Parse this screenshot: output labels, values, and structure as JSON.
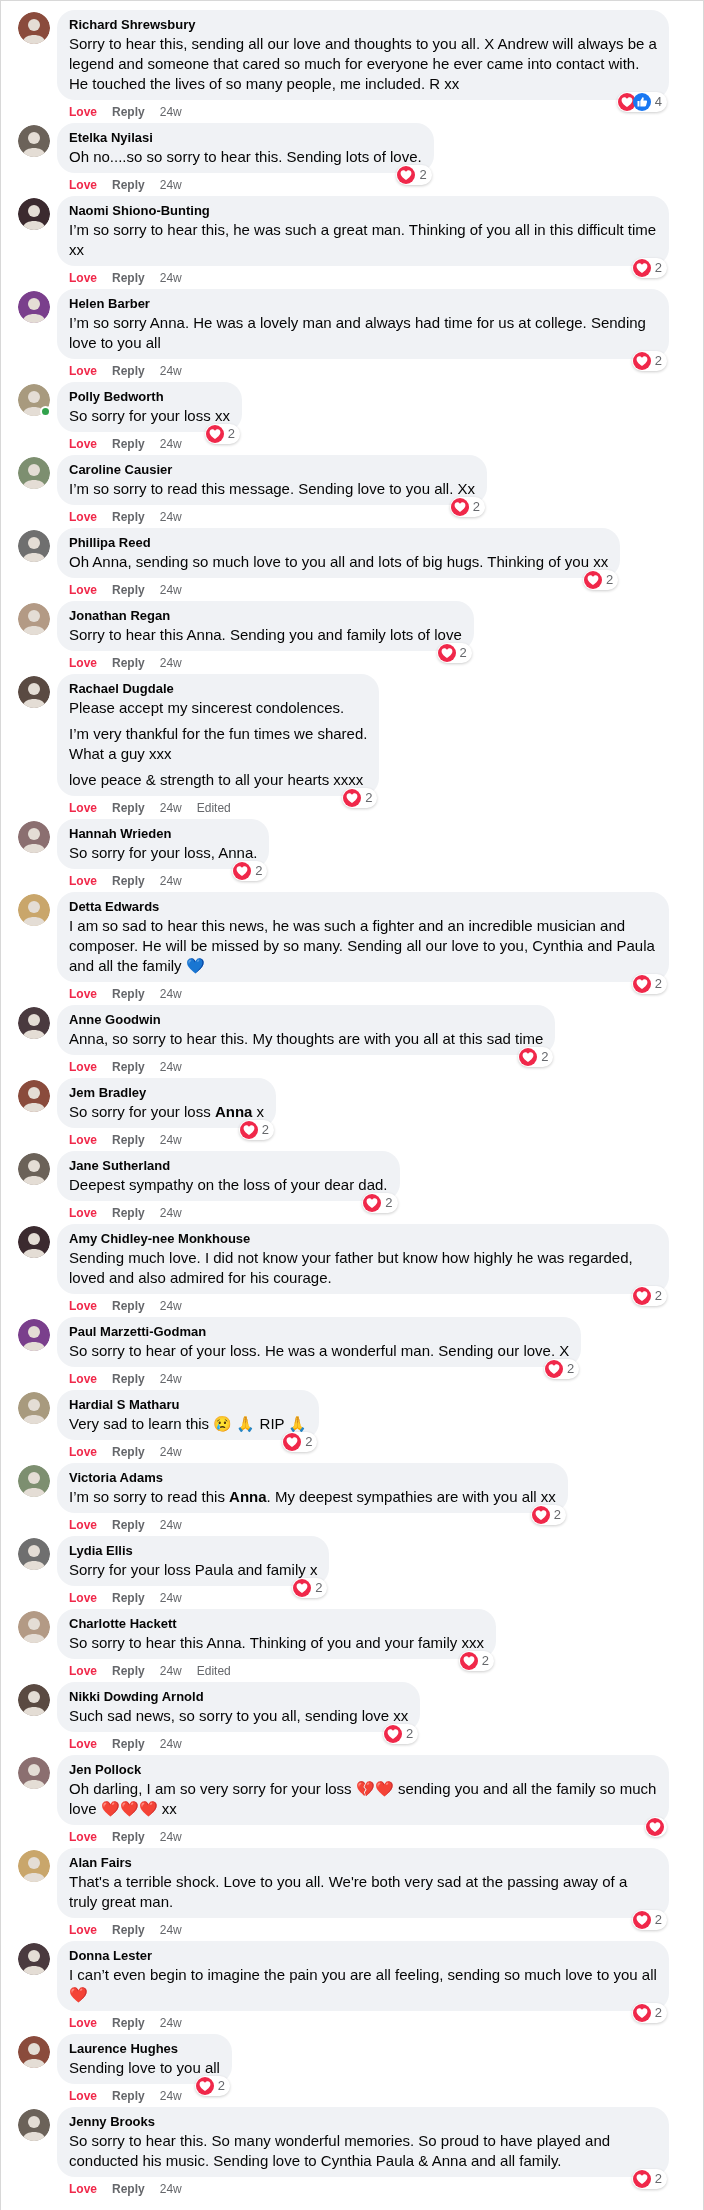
{
  "comments": [
    {
      "author": "Richard Shrewsbury",
      "online": false,
      "paragraphs": [
        "Sorry to hear this, sending all our love and thoughts to you all. X Andrew will always be a legend and someone that cared so much for everyone he ever came into contact with. He touched the lives of so many people, me included. R xx"
      ],
      "loved": true,
      "actions": {
        "love": "Love",
        "reply": "Reply",
        "time": "24w"
      },
      "reactions": {
        "items": [
          {
            "kind": "love"
          },
          {
            "kind": "like"
          }
        ],
        "count": "4"
      }
    },
    {
      "author": "Etelka Nyilasi",
      "online": false,
      "paragraphs": [
        "Oh no....so so sorry to hear this. Sending lots of love."
      ],
      "loved": true,
      "actions": {
        "love": "Love",
        "reply": "Reply",
        "time": "24w"
      },
      "reactions": {
        "items": [
          {
            "kind": "love"
          }
        ],
        "count": "2"
      }
    },
    {
      "author": "Naomi Shiono-Bunting",
      "online": false,
      "paragraphs": [
        "I’m so sorry to hear this, he was such a great man. Thinking of you all in this difficult time xx"
      ],
      "loved": true,
      "actions": {
        "love": "Love",
        "reply": "Reply",
        "time": "24w"
      },
      "reactions": {
        "items": [
          {
            "kind": "love"
          }
        ],
        "count": "2"
      }
    },
    {
      "author": "Helen Barber",
      "online": false,
      "paragraphs": [
        "I’m so sorry Anna. He was a lovely man and always had time for us at college. Sending love to you all"
      ],
      "loved": true,
      "actions": {
        "love": "Love",
        "reply": "Reply",
        "time": "24w"
      },
      "reactions": {
        "items": [
          {
            "kind": "love"
          }
        ],
        "count": "2"
      }
    },
    {
      "author": "Polly Bedworth",
      "online": true,
      "paragraphs": [
        "So sorry for your loss xx"
      ],
      "loved": true,
      "actions": {
        "love": "Love",
        "reply": "Reply",
        "time": "24w"
      },
      "reactions": {
        "items": [
          {
            "kind": "love"
          }
        ],
        "count": "2"
      }
    },
    {
      "author": "Caroline Causier",
      "online": false,
      "paragraphs": [
        "I’m so sorry to read this message. Sending love to you all. Xx"
      ],
      "loved": true,
      "actions": {
        "love": "Love",
        "reply": "Reply",
        "time": "24w"
      },
      "reactions": {
        "items": [
          {
            "kind": "love"
          }
        ],
        "count": "2"
      }
    },
    {
      "author": "Phillipa Reed",
      "online": false,
      "paragraphs": [
        "Oh Anna, sending so much love to you all and lots of big hugs. Thinking of you xx"
      ],
      "loved": true,
      "actions": {
        "love": "Love",
        "reply": "Reply",
        "time": "24w"
      },
      "reactions": {
        "items": [
          {
            "kind": "love"
          }
        ],
        "count": "2"
      }
    },
    {
      "author": "Jonathan Regan",
      "online": false,
      "paragraphs": [
        "Sorry to hear this Anna. Sending you and family lots of love"
      ],
      "loved": true,
      "actions": {
        "love": "Love",
        "reply": "Reply",
        "time": "24w"
      },
      "reactions": {
        "items": [
          {
            "kind": "love"
          }
        ],
        "count": "2"
      }
    },
    {
      "author": "Rachael Dugdale",
      "online": false,
      "paragraphs": [
        "Please accept my sincerest condolences.",
        "I’m very thankful for the fun times we shared.\nWhat a guy xxx",
        "love peace & strength to all your hearts xxxx"
      ],
      "loved": true,
      "actions": {
        "love": "Love",
        "reply": "Reply",
        "time": "24w",
        "edited": "Edited"
      },
      "reactions": {
        "items": [
          {
            "kind": "love"
          }
        ],
        "count": "2"
      }
    },
    {
      "author": "Hannah Wrieden",
      "online": false,
      "paragraphs": [
        "So sorry for your loss, Anna."
      ],
      "loved": true,
      "actions": {
        "love": "Love",
        "reply": "Reply",
        "time": "24w"
      },
      "reactions": {
        "items": [
          {
            "kind": "love"
          }
        ],
        "count": "2"
      }
    },
    {
      "author": "Detta Edwards",
      "online": false,
      "paragraphs": [
        "I am so sad to hear this news, he was such a fighter and an incredible musician and composer. He will be missed by so many. Sending all our love to you, Cynthia and Paula and all the family 💙"
      ],
      "loved": true,
      "actions": {
        "love": "Love",
        "reply": "Reply",
        "time": "24w"
      },
      "reactions": {
        "items": [
          {
            "kind": "love"
          }
        ],
        "count": "2"
      }
    },
    {
      "author": "Anne Goodwin",
      "online": false,
      "paragraphs": [
        "Anna, so sorry to hear this. My thoughts are with you all at this sad time"
      ],
      "loved": true,
      "actions": {
        "love": "Love",
        "reply": "Reply",
        "time": "24w"
      },
      "reactions": {
        "items": [
          {
            "kind": "love"
          }
        ],
        "count": "2"
      }
    },
    {
      "author": "Jem Bradley",
      "online": false,
      "paragraphs": [
        "So sorry for your loss **Anna** x"
      ],
      "loved": true,
      "actions": {
        "love": "Love",
        "reply": "Reply",
        "time": "24w"
      },
      "reactions": {
        "items": [
          {
            "kind": "love"
          }
        ],
        "count": "2"
      }
    },
    {
      "author": "Jane Sutherland",
      "online": false,
      "paragraphs": [
        "Deepest sympathy on the loss of your dear dad."
      ],
      "loved": true,
      "actions": {
        "love": "Love",
        "reply": "Reply",
        "time": "24w"
      },
      "reactions": {
        "items": [
          {
            "kind": "love"
          }
        ],
        "count": "2"
      }
    },
    {
      "author": "Amy Chidley-nee Monkhouse",
      "online": false,
      "paragraphs": [
        "Sending much love. I did not know your father but know how highly he was regarded, loved and also admired for his courage."
      ],
      "loved": true,
      "actions": {
        "love": "Love",
        "reply": "Reply",
        "time": "24w"
      },
      "reactions": {
        "items": [
          {
            "kind": "love"
          }
        ],
        "count": "2"
      }
    },
    {
      "author": "Paul Marzetti-Godman",
      "online": false,
      "paragraphs": [
        "So sorry to hear of your loss. He was a wonderful man. Sending our love. X"
      ],
      "loved": true,
      "actions": {
        "love": "Love",
        "reply": "Reply",
        "time": "24w"
      },
      "reactions": {
        "items": [
          {
            "kind": "love"
          }
        ],
        "count": "2"
      }
    },
    {
      "author": "Hardial S Matharu",
      "online": false,
      "paragraphs": [
        "Very sad to learn this 😢 🙏 RIP 🙏"
      ],
      "loved": true,
      "actions": {
        "love": "Love",
        "reply": "Reply",
        "time": "24w"
      },
      "reactions": {
        "items": [
          {
            "kind": "love"
          }
        ],
        "count": "2"
      }
    },
    {
      "author": "Victoria Adams",
      "online": false,
      "paragraphs": [
        "I’m so sorry to read this **Anna**. My deepest sympathies are with you all xx"
      ],
      "loved": true,
      "actions": {
        "love": "Love",
        "reply": "Reply",
        "time": "24w"
      },
      "reactions": {
        "items": [
          {
            "kind": "love"
          }
        ],
        "count": "2"
      }
    },
    {
      "author": "Lydia Ellis",
      "online": false,
      "paragraphs": [
        "Sorry for your loss Paula and family x"
      ],
      "loved": true,
      "actions": {
        "love": "Love",
        "reply": "Reply",
        "time": "24w"
      },
      "reactions": {
        "items": [
          {
            "kind": "love"
          }
        ],
        "count": "2"
      }
    },
    {
      "author": "Charlotte Hackett",
      "online": false,
      "paragraphs": [
        "So sorry to hear this Anna. Thinking of you and your family xxx"
      ],
      "loved": true,
      "actions": {
        "love": "Love",
        "reply": "Reply",
        "time": "24w",
        "edited": "Edited"
      },
      "reactions": {
        "items": [
          {
            "kind": "love"
          }
        ],
        "count": "2"
      }
    },
    {
      "author": "Nikki Dowding Arnold",
      "online": false,
      "paragraphs": [
        "Such sad news, so sorry to you all, sending love xx"
      ],
      "loved": true,
      "actions": {
        "love": "Love",
        "reply": "Reply",
        "time": "24w"
      },
      "reactions": {
        "items": [
          {
            "kind": "love"
          }
        ],
        "count": "2"
      }
    },
    {
      "author": "Jen Pollock",
      "online": false,
      "paragraphs": [
        "Oh darling, I am so very sorry for your loss 💔❤️ sending you and all the family so much love ❤️❤️❤️ xx"
      ],
      "loved": true,
      "actions": {
        "love": "Love",
        "reply": "Reply",
        "time": "24w"
      },
      "reactions": {
        "items": [
          {
            "kind": "love"
          }
        ]
      }
    },
    {
      "author": "Alan Fairs",
      "online": false,
      "paragraphs": [
        "That's a terrible shock. Love to you all. We're both very sad at the passing away of a truly great man."
      ],
      "loved": true,
      "actions": {
        "love": "Love",
        "reply": "Reply",
        "time": "24w"
      },
      "reactions": {
        "items": [
          {
            "kind": "love"
          }
        ],
        "count": "2"
      }
    },
    {
      "author": "Donna Lester",
      "online": false,
      "paragraphs": [
        "I can’t even begin to imagine the pain you are all feeling, sending so much love to you all ❤️"
      ],
      "loved": true,
      "actions": {
        "love": "Love",
        "reply": "Reply",
        "time": "24w"
      },
      "reactions": {
        "items": [
          {
            "kind": "love"
          }
        ],
        "count": "2"
      }
    },
    {
      "author": "Laurence Hughes",
      "online": false,
      "paragraphs": [
        "Sending love to you all"
      ],
      "loved": true,
      "actions": {
        "love": "Love",
        "reply": "Reply",
        "time": "24w"
      },
      "reactions": {
        "items": [
          {
            "kind": "love"
          }
        ],
        "count": "2"
      }
    },
    {
      "author": "Jenny Brooks",
      "online": false,
      "paragraphs": [
        "So sorry to hear this. So many wonderful memories. So proud to have played and conducted his music. Sending love to Cynthia Paula & Anna and all family."
      ],
      "loved": true,
      "actions": {
        "love": "Love",
        "reply": "Reply",
        "time": "24w"
      },
      "reactions": {
        "items": [
          {
            "kind": "love"
          }
        ],
        "count": "2"
      }
    }
  ]
}
